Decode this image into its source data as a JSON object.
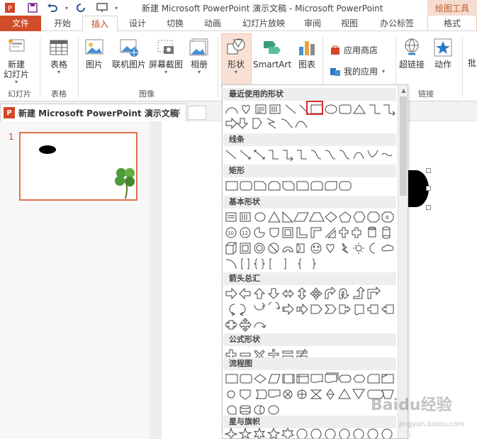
{
  "window": {
    "title": "新建 Microsoft PowerPoint 演示文稿 - Microsoft PowerPoint",
    "contextual_tools": "绘图工具"
  },
  "tabs": [
    "文件",
    "开始",
    "插入",
    "设计",
    "切换",
    "动画",
    "幻灯片放映",
    "审阅",
    "视图",
    "办公标签",
    "格式"
  ],
  "active_tab": "插入",
  "ribbon": {
    "new_slide_1": "新建",
    "new_slide_2": "幻灯片",
    "table": "表格",
    "picture": "图片",
    "online_picture": "联机图片",
    "screenshot": "屏幕截图",
    "album": "相册",
    "shapes": "形状",
    "smartart": "SmartArt",
    "chart": "图表",
    "app_store": "应用商店",
    "my_apps": "我的应用",
    "hyperlink": "超链接",
    "action": "动作",
    "cut_off": "批",
    "groups": {
      "slides": "幻灯片",
      "tables": "表格",
      "images": "图像",
      "links": "链接"
    }
  },
  "document_tab": {
    "name": "新建 Microsoft PowerPoint 演示文稿",
    "icon_letter": "P"
  },
  "thumbnail": {
    "slide_number": "1"
  },
  "shapes_gallery": {
    "sections": [
      {
        "title": "最近使用的形状"
      },
      {
        "title": "线条"
      },
      {
        "title": "矩形"
      },
      {
        "title": "基本形状"
      },
      {
        "title": "箭头总汇"
      },
      {
        "title": "公式形状"
      },
      {
        "title": "流程图"
      },
      {
        "title": "星与旗帜"
      }
    ]
  },
  "watermark": {
    "text": "Baidu经验",
    "sub": "jingyan.baidu.com"
  },
  "colors": {
    "accent": "#d24726",
    "file_tab": "#d14d2a",
    "active_tab_text": "#c43e1c",
    "selection": "#e02a2a"
  }
}
